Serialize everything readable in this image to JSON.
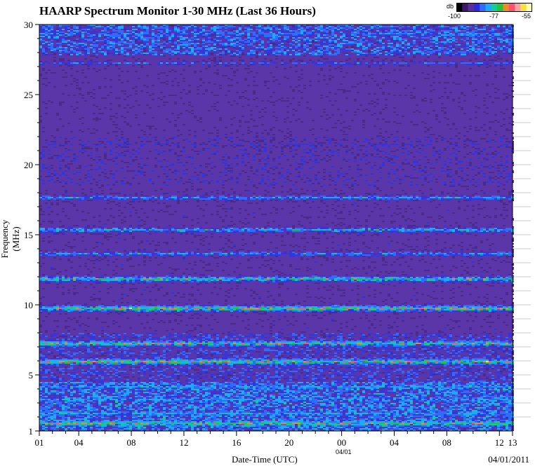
{
  "title": "HAARP Spectrum Monitor 1-30 MHz (Last 36 Hours)",
  "legend": {
    "unit": "db",
    "min_label": "-100",
    "mid_label": "-77",
    "max_label": "-55",
    "colors": [
      "#000000",
      "#3b1a6e",
      "#5a2ea0",
      "#2a2adf",
      "#2f6bff",
      "#1fa8ff",
      "#14c8a0",
      "#22c43a",
      "#f08a28",
      "#ff5070",
      "#f7a4a0",
      "#f8e040",
      "#ffffb0"
    ]
  },
  "xlabel": "Date-Time (UTC)",
  "ylabel": "Frequency (MHz)",
  "day_marker": "04/01",
  "footer_date": "04/01/2011",
  "chart_data": {
    "type": "heatmap",
    "title": "HAARP Spectrum Monitor 1-30 MHz (Last 36 Hours)",
    "xlabel": "Date-Time (UTC)",
    "ylabel": "Frequency (MHz)",
    "x_tick_labels": [
      "01",
      "04",
      "08",
      "12",
      "16",
      "20",
      "00",
      "04",
      "08",
      "12",
      "13"
    ],
    "x_tick_hours": [
      0,
      3,
      7,
      11,
      15,
      19,
      23,
      27,
      31,
      35,
      36
    ],
    "y_tick_labels": [
      "1",
      "5",
      "10",
      "15",
      "20",
      "25",
      "30"
    ],
    "y_tick_values": [
      1,
      5,
      10,
      15,
      20,
      25,
      30
    ],
    "ylim": [
      1,
      30
    ],
    "xlim_hours": [
      0,
      36
    ],
    "colorbar": {
      "unit": "db",
      "min": -100,
      "max": -55,
      "mid": -77
    },
    "bands": [
      {
        "freq": 1.6,
        "intensity": 0.75
      },
      {
        "freq": 2.3,
        "intensity": 0.55
      },
      {
        "freq": 3.3,
        "intensity": 0.5
      },
      {
        "freq": 4.2,
        "intensity": 0.55
      },
      {
        "freq": 6.0,
        "intensity": 0.8
      },
      {
        "freq": 7.3,
        "intensity": 0.75
      },
      {
        "freq": 9.8,
        "intensity": 0.8
      },
      {
        "freq": 11.9,
        "intensity": 0.7
      },
      {
        "freq": 13.7,
        "intensity": 0.55
      },
      {
        "freq": 15.4,
        "intensity": 0.6
      },
      {
        "freq": 17.7,
        "intensity": 0.55
      },
      {
        "freq": 21.5,
        "intensity": 0.35
      },
      {
        "freq": 27.3,
        "intensity": 0.45
      },
      {
        "freq": 29.4,
        "intensity": 0.45
      }
    ]
  }
}
